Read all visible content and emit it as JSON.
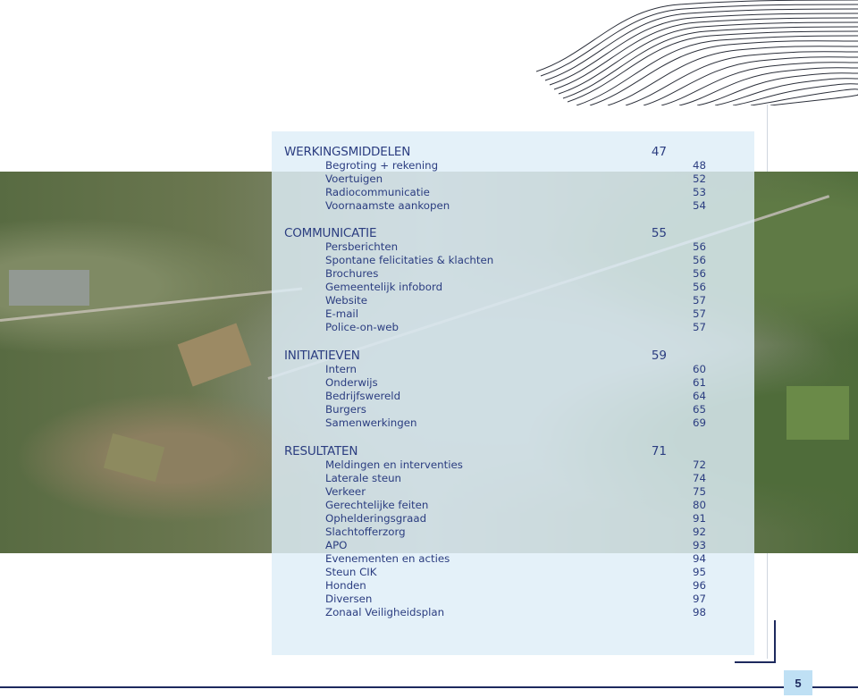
{
  "toc": {
    "sections": [
      {
        "title": "WERKINGSMIDDELEN",
        "page": "47",
        "items": [
          {
            "label": "Begroting + rekening",
            "page": "48"
          },
          {
            "label": "Voertuigen",
            "page": "52"
          },
          {
            "label": "Radiocommunicatie",
            "page": "53"
          },
          {
            "label": "Voornaamste aankopen",
            "page": "54"
          }
        ]
      },
      {
        "title": "COMMUNICATIE",
        "page": "55",
        "items": [
          {
            "label": "Persberichten",
            "page": "56"
          },
          {
            "label": "Spontane felicitaties & klachten",
            "page": "56"
          },
          {
            "label": "Brochures",
            "page": "56"
          },
          {
            "label": "Gemeentelijk infobord",
            "page": "56"
          },
          {
            "label": "Website",
            "page": "57"
          },
          {
            "label": "E-mail",
            "page": "57"
          },
          {
            "label": "Police-on-web",
            "page": "57"
          }
        ]
      },
      {
        "title": "INITIATIEVEN",
        "page": "59",
        "items": [
          {
            "label": "Intern",
            "page": "60"
          },
          {
            "label": "Onderwijs",
            "page": "61"
          },
          {
            "label": "Bedrijfswereld",
            "page": "64"
          },
          {
            "label": "Burgers",
            "page": "65"
          },
          {
            "label": "Samenwerkingen",
            "page": "69"
          }
        ]
      },
      {
        "title": "RESULTATEN",
        "page": "71",
        "items": [
          {
            "label": "Meldingen en interventies",
            "page": "72"
          },
          {
            "label": "Laterale steun",
            "page": "74"
          },
          {
            "label": "Verkeer",
            "page": "75"
          },
          {
            "label": "Gerechtelijke feiten",
            "page": "80"
          },
          {
            "label": "Ophelderingsgraad",
            "page": "91"
          },
          {
            "label": "Slachtofferzorg",
            "page": "92"
          },
          {
            "label": "APO",
            "page": "93"
          },
          {
            "label": "Evenementen en acties",
            "page": "94"
          },
          {
            "label": "Steun CIK",
            "page": "95"
          },
          {
            "label": "Honden",
            "page": "96"
          },
          {
            "label": "Diversen",
            "page": "97"
          },
          {
            "label": "Zonaal Veiligheidsplan",
            "page": "98"
          }
        ]
      }
    ]
  },
  "footer": {
    "page_number": "5"
  },
  "colors": {
    "text": "#2b3d80",
    "panel": "#deeef8",
    "badge": "#bfe0f4",
    "rule": "#1e2a5e"
  }
}
